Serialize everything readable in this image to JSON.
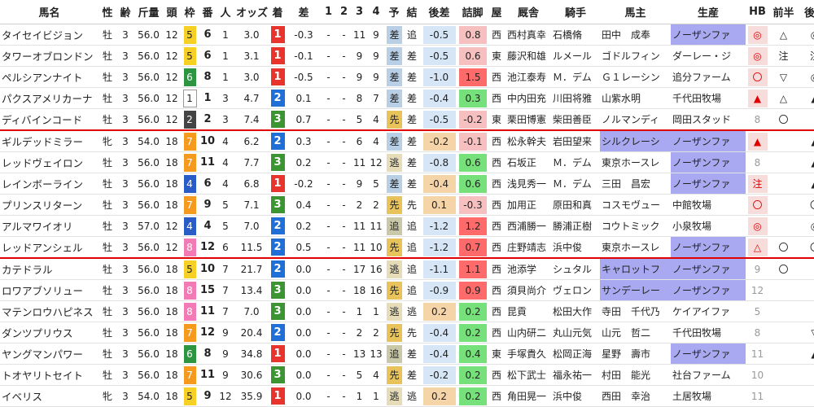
{
  "headers": [
    "馬名",
    "性",
    "齢",
    "斤量",
    "頭",
    "枠",
    "番",
    "人",
    "オッズ",
    "着",
    "差",
    "1",
    "2",
    "3",
    "4",
    "予",
    "結",
    "後差",
    "詰脚",
    "屋",
    "厩舎",
    "騎手",
    "馬主",
    "生産",
    "HB",
    "前半",
    "後半"
  ],
  "rows": [
    {
      "name": "タイセイビジョン",
      "sex": "牡",
      "age": "3",
      "kin": "56.0",
      "tou": "12",
      "waku": "5",
      "ban": "6",
      "ninki": "1",
      "odds": "3.0",
      "chaku": "1",
      "sa": "-0.3",
      "c1": "-",
      "c2": "-",
      "c3": "11",
      "c4": "9",
      "yo": "差",
      "yo_c": "sa",
      "ke": "追",
      "gosa": "-0.5",
      "gosa_c": "b",
      "tsume": "0.8",
      "tsume_c": "p",
      "kyu": "西",
      "kyusha": "西村真幸",
      "kishu": "石橋脩",
      "banushi": "田中　成奉",
      "banushi_c": "",
      "seisan": "ノーザンファ",
      "seisan_c": "blue",
      "hb": "◎",
      "hb_c": "on",
      "zen": "△",
      "zen_c": "b",
      "kou": "◎",
      "kou_c": "g",
      "sep": false
    },
    {
      "name": "タワーオブロンドン",
      "sex": "牡",
      "age": "3",
      "kin": "56.0",
      "tou": "12",
      "waku": "5",
      "ban": "6",
      "ninki": "1",
      "odds": "3.1",
      "chaku": "1",
      "sa": "-0.1",
      "c1": "-",
      "c2": "-",
      "c3": "9",
      "c4": "9",
      "yo": "差",
      "yo_c": "sa",
      "ke": "差",
      "gosa": "-0.5",
      "gosa_c": "b",
      "tsume": "0.6",
      "tsume_c": "p",
      "kyu": "東",
      "kyusha": "藤沢和雄",
      "kishu": "ルメール",
      "banushi": "ゴドルフィン",
      "banushi_c": "",
      "seisan": "ダーレー・ジ",
      "seisan_c": "",
      "hb": "◎",
      "hb_c": "on",
      "zen": "注",
      "zen_c": "b",
      "kou": "注",
      "kou_c": "g",
      "sep": false
    },
    {
      "name": "ペルシアンナイト",
      "sex": "牡",
      "age": "3",
      "kin": "56.0",
      "tou": "12",
      "waku": "6",
      "ban": "8",
      "ninki": "1",
      "odds": "3.0",
      "chaku": "1",
      "sa": "-0.5",
      "c1": "-",
      "c2": "-",
      "c3": "9",
      "c4": "9",
      "yo": "差",
      "yo_c": "sa",
      "ke": "差",
      "gosa": "-1.0",
      "gosa_c": "b",
      "tsume": "1.5",
      "tsume_c": "r",
      "kyu": "西",
      "kyusha": "池江泰寿",
      "kishu": "Ｍ．デム",
      "banushi": "Ｇ１レーシン",
      "banushi_c": "",
      "seisan": "追分ファーム",
      "seisan_c": "",
      "hb": "〇",
      "hb_c": "on",
      "zen": "▽",
      "zen_c": "b",
      "kou": "◎",
      "kou_c": "g",
      "sep": false
    },
    {
      "name": "パクスアメリカーナ",
      "sex": "牡",
      "age": "3",
      "kin": "56.0",
      "tou": "12",
      "waku": "1",
      "ban": "1",
      "ninki": "3",
      "odds": "4.7",
      "chaku": "2",
      "sa": "0.1",
      "c1": "-",
      "c2": "-",
      "c3": "8",
      "c4": "7",
      "yo": "差",
      "yo_c": "sa",
      "ke": "差",
      "gosa": "-0.4",
      "gosa_c": "b",
      "tsume": "0.3",
      "tsume_c": "g",
      "kyu": "西",
      "kyusha": "中内田充",
      "kishu": "川田将雅",
      "banushi": "山紫水明",
      "banushi_c": "",
      "seisan": "千代田牧場",
      "seisan_c": "",
      "hb": "▲",
      "hb_c": "on",
      "zen": "△",
      "zen_c": "b",
      "kou": "▲",
      "kou_c": "g",
      "sep": false
    },
    {
      "name": "ディバインコード",
      "sex": "牡",
      "age": "3",
      "kin": "56.0",
      "tou": "12",
      "waku": "2",
      "ban": "2",
      "ninki": "3",
      "odds": "7.4",
      "chaku": "3",
      "sa": "0.7",
      "c1": "-",
      "c2": "-",
      "c3": "5",
      "c4": "4",
      "yo": "先",
      "yo_c": "sen",
      "ke": "差",
      "gosa": "-0.5",
      "gosa_c": "b",
      "tsume": "-0.2",
      "tsume_c": "p",
      "kyu": "東",
      "kyusha": "栗田博憲",
      "kishu": "柴田善臣",
      "banushi": "ノルマンディ",
      "banushi_c": "",
      "seisan": "岡田スタッド",
      "seisan_c": "",
      "hb": "8",
      "hb_c": "off",
      "zen": "〇",
      "zen_c": "b",
      "kou": "",
      "kou_c": "g",
      "sep": true
    },
    {
      "name": "ギルデッドミラー",
      "sex": "牝",
      "age": "3",
      "kin": "54.0",
      "tou": "18",
      "waku": "7",
      "ban": "10",
      "ninki": "4",
      "odds": "6.2",
      "chaku": "2",
      "sa": "0.3",
      "c1": "-",
      "c2": "-",
      "c3": "6",
      "c4": "4",
      "yo": "差",
      "yo_c": "sa",
      "ke": "差",
      "gosa": "-0.2",
      "gosa_c": "o",
      "tsume": "-0.1",
      "tsume_c": "p",
      "kyu": "西",
      "kyusha": "松永幹夫",
      "kishu": "岩田望来",
      "banushi": "シルクレーシ",
      "banushi_c": "blue",
      "seisan": "ノーザンファ",
      "seisan_c": "blue",
      "hb": "▲",
      "hb_c": "on",
      "zen": "",
      "zen_c": "b",
      "kou": "▲",
      "kou_c": "g",
      "sep": false
    },
    {
      "name": "レッドヴェイロン",
      "sex": "牡",
      "age": "3",
      "kin": "56.0",
      "tou": "18",
      "waku": "7",
      "ban": "11",
      "ninki": "4",
      "odds": "7.7",
      "chaku": "3",
      "sa": "0.2",
      "c1": "-",
      "c2": "-",
      "c3": "11",
      "c4": "12",
      "yo": "逃",
      "yo_c": "ni",
      "ke": "差",
      "gosa": "-0.8",
      "gosa_c": "b",
      "tsume": "0.6",
      "tsume_c": "g",
      "kyu": "西",
      "kyusha": "石坂正",
      "kishu": "Ｍ．デム",
      "banushi": "東京ホースレ",
      "banushi_c": "",
      "seisan": "ノーザンファ",
      "seisan_c": "blue",
      "hb": "8",
      "hb_c": "off",
      "zen": "",
      "zen_c": "b",
      "kou": "▲",
      "kou_c": "g",
      "sep": false
    },
    {
      "name": "レインボーライン",
      "sex": "牡",
      "age": "3",
      "kin": "56.0",
      "tou": "18",
      "waku": "4",
      "ban": "6",
      "ninki": "4",
      "odds": "6.8",
      "chaku": "1",
      "sa": "-0.2",
      "c1": "-",
      "c2": "-",
      "c3": "9",
      "c4": "5",
      "yo": "差",
      "yo_c": "sa",
      "ke": "差",
      "gosa": "-0.4",
      "gosa_c": "o",
      "tsume": "0.6",
      "tsume_c": "g",
      "kyu": "西",
      "kyusha": "浅見秀一",
      "kishu": "Ｍ．デム",
      "banushi": "三田　昌宏",
      "banushi_c": "",
      "seisan": "ノーザンファ",
      "seisan_c": "blue",
      "hb": "注",
      "hb_c": "on",
      "zen": "",
      "zen_c": "b",
      "kou": "▲",
      "kou_c": "g",
      "sep": false
    },
    {
      "name": "プリンスリターン",
      "sex": "牡",
      "age": "3",
      "kin": "56.0",
      "tou": "18",
      "waku": "7",
      "ban": "9",
      "ninki": "5",
      "odds": "7.1",
      "chaku": "3",
      "sa": "0.4",
      "c1": "-",
      "c2": "-",
      "c3": "2",
      "c4": "2",
      "yo": "先",
      "yo_c": "sen",
      "ke": "先",
      "gosa": "0.1",
      "gosa_c": "o",
      "tsume": "-0.3",
      "tsume_c": "p",
      "kyu": "西",
      "kyusha": "加用正",
      "kishu": "原田和真",
      "banushi": "コスモヴュー",
      "banushi_c": "",
      "seisan": "中館牧場",
      "seisan_c": "",
      "hb": "〇",
      "hb_c": "on",
      "zen": "",
      "zen_c": "b",
      "kou": "〇",
      "kou_c": "mk-r",
      "sep": false
    },
    {
      "name": "アルマワイオリ",
      "sex": "牡",
      "age": "3",
      "kin": "57.0",
      "tou": "12",
      "waku": "4",
      "ban": "4",
      "ninki": "5",
      "odds": "7.0",
      "chaku": "2",
      "sa": "0.2",
      "c1": "-",
      "c2": "-",
      "c3": "11",
      "c4": "11",
      "yo": "追",
      "yo_c": "oi",
      "ke": "追",
      "gosa": "-1.2",
      "gosa_c": "b",
      "tsume": "1.2",
      "tsume_c": "r",
      "kyu": "西",
      "kyusha": "西浦勝一",
      "kishu": "勝浦正樹",
      "banushi": "コウトミック",
      "banushi_c": "",
      "seisan": "小泉牧場",
      "seisan_c": "",
      "hb": "◎",
      "hb_c": "on",
      "zen": "",
      "zen_c": "b",
      "kou": "◎",
      "kou_c": "g",
      "sep": false
    },
    {
      "name": "レッドアンシェル",
      "sex": "牡",
      "age": "3",
      "kin": "56.0",
      "tou": "12",
      "waku": "8",
      "ban": "12",
      "ninki": "6",
      "odds": "11.5",
      "chaku": "2",
      "sa": "0.5",
      "c1": "-",
      "c2": "-",
      "c3": "11",
      "c4": "10",
      "yo": "先",
      "yo_c": "sen",
      "ke": "追",
      "gosa": "-1.2",
      "gosa_c": "b",
      "tsume": "0.7",
      "tsume_c": "r",
      "kyu": "西",
      "kyusha": "庄野靖志",
      "kishu": "浜中俊",
      "banushi": "東京ホースレ",
      "banushi_c": "",
      "seisan": "ノーザンファ",
      "seisan_c": "blue",
      "hb": "△",
      "hb_c": "on",
      "zen": "〇",
      "zen_c": "b",
      "kou": "〇",
      "kou_c": "g",
      "sep": true
    },
    {
      "name": "カテドラル",
      "sex": "牡",
      "age": "3",
      "kin": "56.0",
      "tou": "18",
      "waku": "5",
      "ban": "10",
      "ninki": "7",
      "odds": "21.7",
      "chaku": "2",
      "sa": "0.0",
      "c1": "-",
      "c2": "-",
      "c3": "17",
      "c4": "16",
      "yo": "逃",
      "yo_c": "ni",
      "ke": "追",
      "gosa": "-1.1",
      "gosa_c": "b",
      "tsume": "1.1",
      "tsume_c": "r",
      "kyu": "西",
      "kyusha": "池添学",
      "kishu": "シュタル",
      "banushi": "キャロットフ",
      "banushi_c": "blue",
      "seisan": "ノーザンファ",
      "seisan_c": "blue",
      "hb": "9",
      "hb_c": "off",
      "zen": "〇",
      "zen_c": "b",
      "kou": "",
      "kou_c": "g",
      "sep": false
    },
    {
      "name": "ロワアブソリュー",
      "sex": "牡",
      "age": "3",
      "kin": "56.0",
      "tou": "18",
      "waku": "8",
      "ban": "15",
      "ninki": "7",
      "odds": "13.4",
      "chaku": "3",
      "sa": "0.0",
      "c1": "-",
      "c2": "-",
      "c3": "18",
      "c4": "16",
      "yo": "先",
      "yo_c": "sen",
      "ke": "追",
      "gosa": "-0.9",
      "gosa_c": "b",
      "tsume": "0.9",
      "tsume_c": "r",
      "kyu": "西",
      "kyusha": "須貝尚介",
      "kishu": "ヴェロン",
      "banushi": "サンデーレー",
      "banushi_c": "blue",
      "seisan": "ノーザンファ",
      "seisan_c": "blue",
      "hb": "12",
      "hb_c": "off",
      "zen": "",
      "zen_c": "b",
      "kou": "",
      "kou_c": "g",
      "sep": false
    },
    {
      "name": "マテンロウハピネス",
      "sex": "牡",
      "age": "3",
      "kin": "56.0",
      "tou": "18",
      "waku": "8",
      "ban": "11",
      "ninki": "7",
      "odds": "7.0",
      "chaku": "3",
      "sa": "0.0",
      "c1": "-",
      "c2": "-",
      "c3": "1",
      "c4": "1",
      "yo": "逃",
      "yo_c": "ni",
      "ke": "逃",
      "gosa": "0.2",
      "gosa_c": "o",
      "tsume": "0.2",
      "tsume_c": "g",
      "kyu": "西",
      "kyusha": "昆貢",
      "kishu": "松田大作",
      "banushi": "寺田　千代乃",
      "banushi_c": "",
      "seisan": "ケイアイファ",
      "seisan_c": "",
      "hb": "5",
      "hb_c": "off",
      "zen": "",
      "zen_c": "b",
      "kou": "",
      "kou_c": "g",
      "sep": false
    },
    {
      "name": "ダンツプリウス",
      "sex": "牡",
      "age": "3",
      "kin": "56.0",
      "tou": "18",
      "waku": "7",
      "ban": "12",
      "ninki": "9",
      "odds": "20.4",
      "chaku": "2",
      "sa": "0.0",
      "c1": "-",
      "c2": "-",
      "c3": "2",
      "c4": "2",
      "yo": "先",
      "yo_c": "sen",
      "ke": "先",
      "gosa": "-0.4",
      "gosa_c": "b",
      "tsume": "0.2",
      "tsume_c": "g",
      "kyu": "西",
      "kyusha": "山内研二",
      "kishu": "丸山元気",
      "banushi": "山元　哲二",
      "banushi_c": "",
      "seisan": "千代田牧場",
      "seisan_c": "",
      "hb": "8",
      "hb_c": "off",
      "zen": "",
      "zen_c": "b",
      "kou": "▽",
      "kou_c": "g",
      "sep": false
    },
    {
      "name": "ヤングマンパワー",
      "sex": "牡",
      "age": "3",
      "kin": "56.0",
      "tou": "18",
      "waku": "6",
      "ban": "8",
      "ninki": "9",
      "odds": "34.8",
      "chaku": "1",
      "sa": "0.0",
      "c1": "-",
      "c2": "-",
      "c3": "13",
      "c4": "13",
      "yo": "追",
      "yo_c": "oi",
      "ke": "差",
      "gosa": "-0.4",
      "gosa_c": "b",
      "tsume": "0.4",
      "tsume_c": "g",
      "kyu": "東",
      "kyusha": "手塚貴久",
      "kishu": "松岡正海",
      "banushi": "星野　壽市",
      "banushi_c": "",
      "seisan": "ノーザンファ",
      "seisan_c": "blue",
      "hb": "11",
      "hb_c": "off",
      "zen": "",
      "zen_c": "b",
      "kou": "▲",
      "kou_c": "g",
      "sep": false
    },
    {
      "name": "トオヤリトセイト",
      "sex": "牡",
      "age": "3",
      "kin": "56.0",
      "tou": "18",
      "waku": "7",
      "ban": "11",
      "ninki": "9",
      "odds": "30.6",
      "chaku": "3",
      "sa": "0.0",
      "c1": "-",
      "c2": "-",
      "c3": "5",
      "c4": "4",
      "yo": "先",
      "yo_c": "sen",
      "ke": "差",
      "gosa": "-0.2",
      "gosa_c": "b",
      "tsume": "0.2",
      "tsume_c": "g",
      "kyu": "西",
      "kyusha": "松下武士",
      "kishu": "福永祐一",
      "banushi": "村田　能光",
      "banushi_c": "",
      "seisan": "社台ファーム",
      "seisan_c": "",
      "hb": "10",
      "hb_c": "off",
      "zen": "",
      "zen_c": "b",
      "kou": "",
      "kou_c": "g",
      "sep": false
    },
    {
      "name": "イベリス",
      "sex": "牝",
      "age": "3",
      "kin": "54.0",
      "tou": "18",
      "waku": "5",
      "ban": "9",
      "ninki": "12",
      "odds": "35.9",
      "chaku": "1",
      "sa": "0.0",
      "c1": "-",
      "c2": "-",
      "c3": "1",
      "c4": "1",
      "yo": "逃",
      "yo_c": "ni",
      "ke": "逃",
      "gosa": "0.2",
      "gosa_c": "o",
      "tsume": "0.2",
      "tsume_c": "g",
      "kyu": "西",
      "kyusha": "角田晃一",
      "kishu": "浜中俊",
      "banushi": "西田　幸治",
      "banushi_c": "",
      "seisan": "土居牧場",
      "seisan_c": "",
      "hb": "11",
      "hb_c": "off",
      "zen": "",
      "zen_c": "b",
      "kou": "",
      "kou_c": "g",
      "sep": false
    }
  ]
}
